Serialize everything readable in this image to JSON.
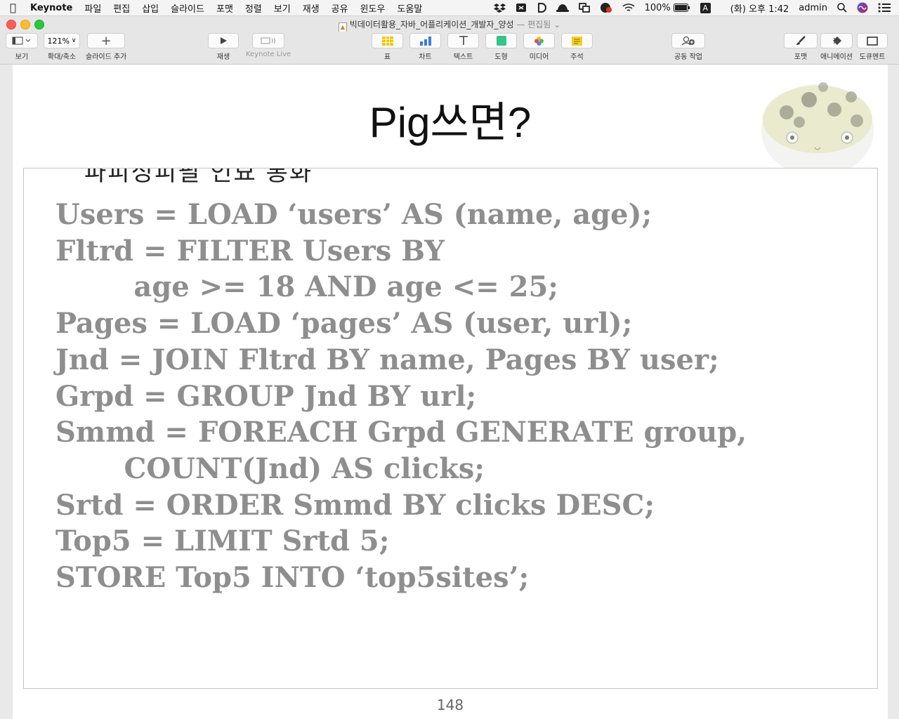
{
  "menubar": {
    "app_name": "Keynote",
    "items": [
      "파일",
      "편집",
      "삽입",
      "슬라이드",
      "포맷",
      "정렬",
      "보기",
      "재생",
      "공유",
      "윈도우",
      "도움말"
    ],
    "battery": "100%",
    "input_mode": "A",
    "datetime": "(화) 오후 1:42",
    "user": "admin"
  },
  "window": {
    "document_title": "빅데이터활용_자바_어플리케이션_개발자_양성",
    "status": "— 편집됨"
  },
  "toolbar": {
    "view_label": "보기",
    "zoom_value": "121%",
    "zoom_label": "확대/축소",
    "add_slide_label": "슬라이드 추가",
    "play_label": "재생",
    "keynote_live_label": "Keynote Live",
    "table_label": "표",
    "chart_label": "차트",
    "text_label": "텍스트",
    "shape_label": "도형",
    "media_label": "미디어",
    "comment_label": "주석",
    "collab_label": "공동 작업",
    "format_label": "포맷",
    "animate_label": "애니메이션",
    "document_label": "도큐멘트"
  },
  "slide": {
    "title": "Pig쓰면?",
    "clipped_text": "파피싱피필 인묘 통화",
    "code_lines": [
      "Users = LOAD ‘users’ AS (name, age);",
      "Fltrd = FILTER Users BY",
      "        age >= 18 AND age <= 25;",
      "Pages = LOAD ‘pages’ AS (user, url);",
      "Jnd = JOIN Fltrd BY name, Pages BY user;",
      "Grpd = GROUP Jnd BY url;",
      "Smmd = FOREACH Grpd GENERATE group,",
      "       COUNT(Jnd) AS clicks;",
      "Srtd = ORDER Smmd BY clicks DESC;",
      "Top5 = LIMIT Srtd 5;",
      "STORE Top5 INTO ‘top5sites’;"
    ],
    "page_number": "148"
  },
  "colors": {
    "close": "#fe5f57",
    "minimize": "#febc2e",
    "zoom": "#28c840",
    "code_text": "#8e8e8e"
  }
}
